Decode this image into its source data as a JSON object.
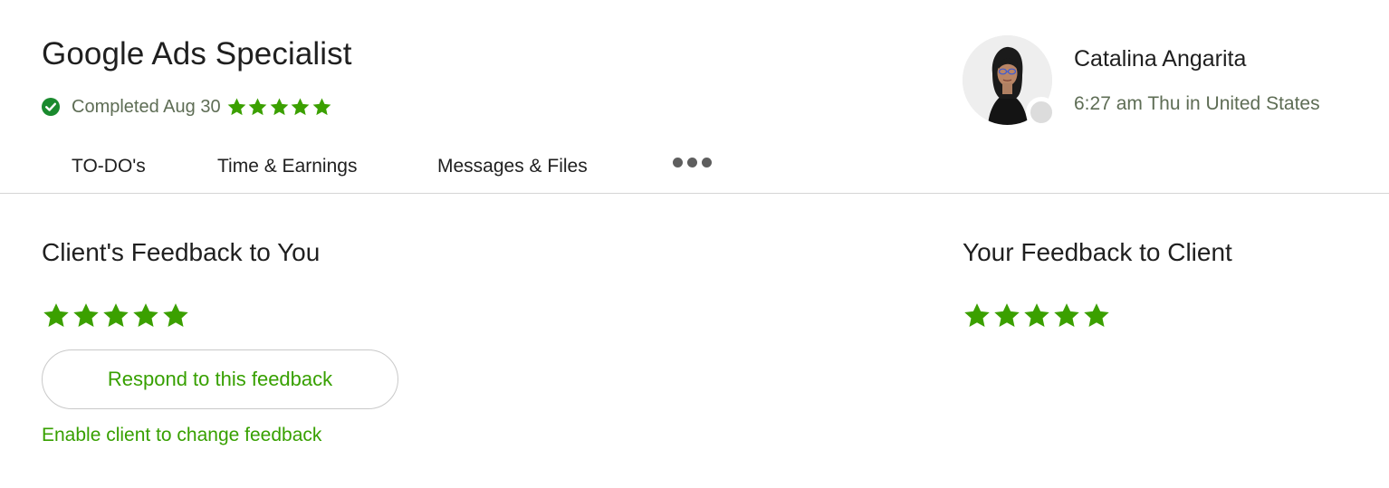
{
  "job": {
    "title": "Google Ads Specialist",
    "status_text": "Completed Aug 30",
    "rating": 5,
    "status_color": "#14a800"
  },
  "client": {
    "name": "Catalina Angarita",
    "local_time": "6:27 am Thu in United States"
  },
  "tabs": [
    {
      "label": "TO-DO's"
    },
    {
      "label": "Time & Earnings"
    },
    {
      "label": "Messages & Files"
    }
  ],
  "more_icon": "more-horizontal-icon",
  "feedback_to_you": {
    "heading": "Client's Feedback to You",
    "rating": 5,
    "respond_label": "Respond to this feedback",
    "enable_label": "Enable client to change feedback"
  },
  "feedback_to_client": {
    "heading": "Your Feedback to Client",
    "rating": 5
  },
  "colors": {
    "accent": "#37a000",
    "star": "#3ba000"
  }
}
